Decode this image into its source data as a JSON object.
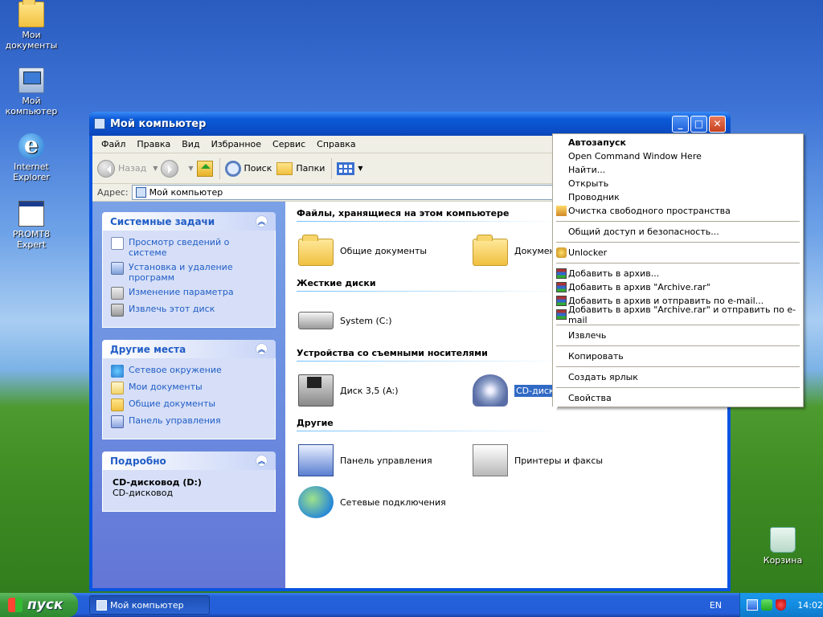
{
  "desktop": {
    "icons": [
      {
        "label": "Мои документы"
      },
      {
        "label": "Мой компьютер"
      },
      {
        "label": "Internet Explorer"
      },
      {
        "label": "PROMT8 Expert"
      },
      {
        "label": "Корзина"
      }
    ]
  },
  "window": {
    "title": "Мой компьютер",
    "menu": [
      "Файл",
      "Правка",
      "Вид",
      "Избранное",
      "Сервис",
      "Справка"
    ],
    "toolbar": {
      "back": "Назад",
      "search": "Поиск",
      "folders": "Папки"
    },
    "address": {
      "label": "Адрес:",
      "value": "Мой компьютер"
    },
    "system_tasks": {
      "title": "Системные задачи",
      "items": [
        "Просмотр сведений о системе",
        "Установка и удаление программ",
        "Изменение параметра",
        "Извлечь этот диск"
      ]
    },
    "other_places": {
      "title": "Другие места",
      "items": [
        "Сетевое окружение",
        "Мои документы",
        "Общие документы",
        "Панель управления"
      ]
    },
    "details": {
      "title": "Подробно",
      "name": "CD-дисковод (D:)",
      "type": "CD-дисковод"
    },
    "groups": {
      "files": {
        "title": "Файлы, хранящиеся на этом компьютере",
        "items": [
          "Общие документы",
          "Документ"
        ]
      },
      "hard_drives": {
        "title": "Жесткие диски",
        "items": [
          "System (C:)"
        ]
      },
      "removable": {
        "title": "Устройства со съемными носителями",
        "items": [
          "Диск 3,5 (A:)",
          "CD-дисковод (D:)"
        ]
      },
      "other": {
        "title": "Другие",
        "items": [
          "Панель управления",
          "Принтеры и факсы",
          "Сетевые подключения"
        ]
      }
    }
  },
  "context_menu": {
    "autorun": "Автозапуск",
    "cmd": "Open Command Window Here",
    "find": "Найти...",
    "open": "Открыть",
    "explorer": "Проводник",
    "wipe": "Очистка свободного пространства",
    "sharing": "Общий доступ и безопасность...",
    "unlocker": "Unlocker",
    "rar_add": "Добавить в архив...",
    "rar_add_named": "Добавить в архив \"Archive.rar\"",
    "rar_add_email": "Добавить в архив и отправить по e-mail...",
    "rar_add_named_email": "Добавить в архив \"Archive.rar\" и отправить по e-mail",
    "eject": "Извлечь",
    "copy": "Копировать",
    "shortcut": "Создать ярлык",
    "properties": "Свойства"
  },
  "taskbar": {
    "start": "пуск",
    "task": "Мой компьютер",
    "lang": "EN",
    "clock": "14:02"
  },
  "colors": {
    "accent": "#215dc6",
    "selection": "#316ac5",
    "title_bar": "#0a55e0"
  }
}
